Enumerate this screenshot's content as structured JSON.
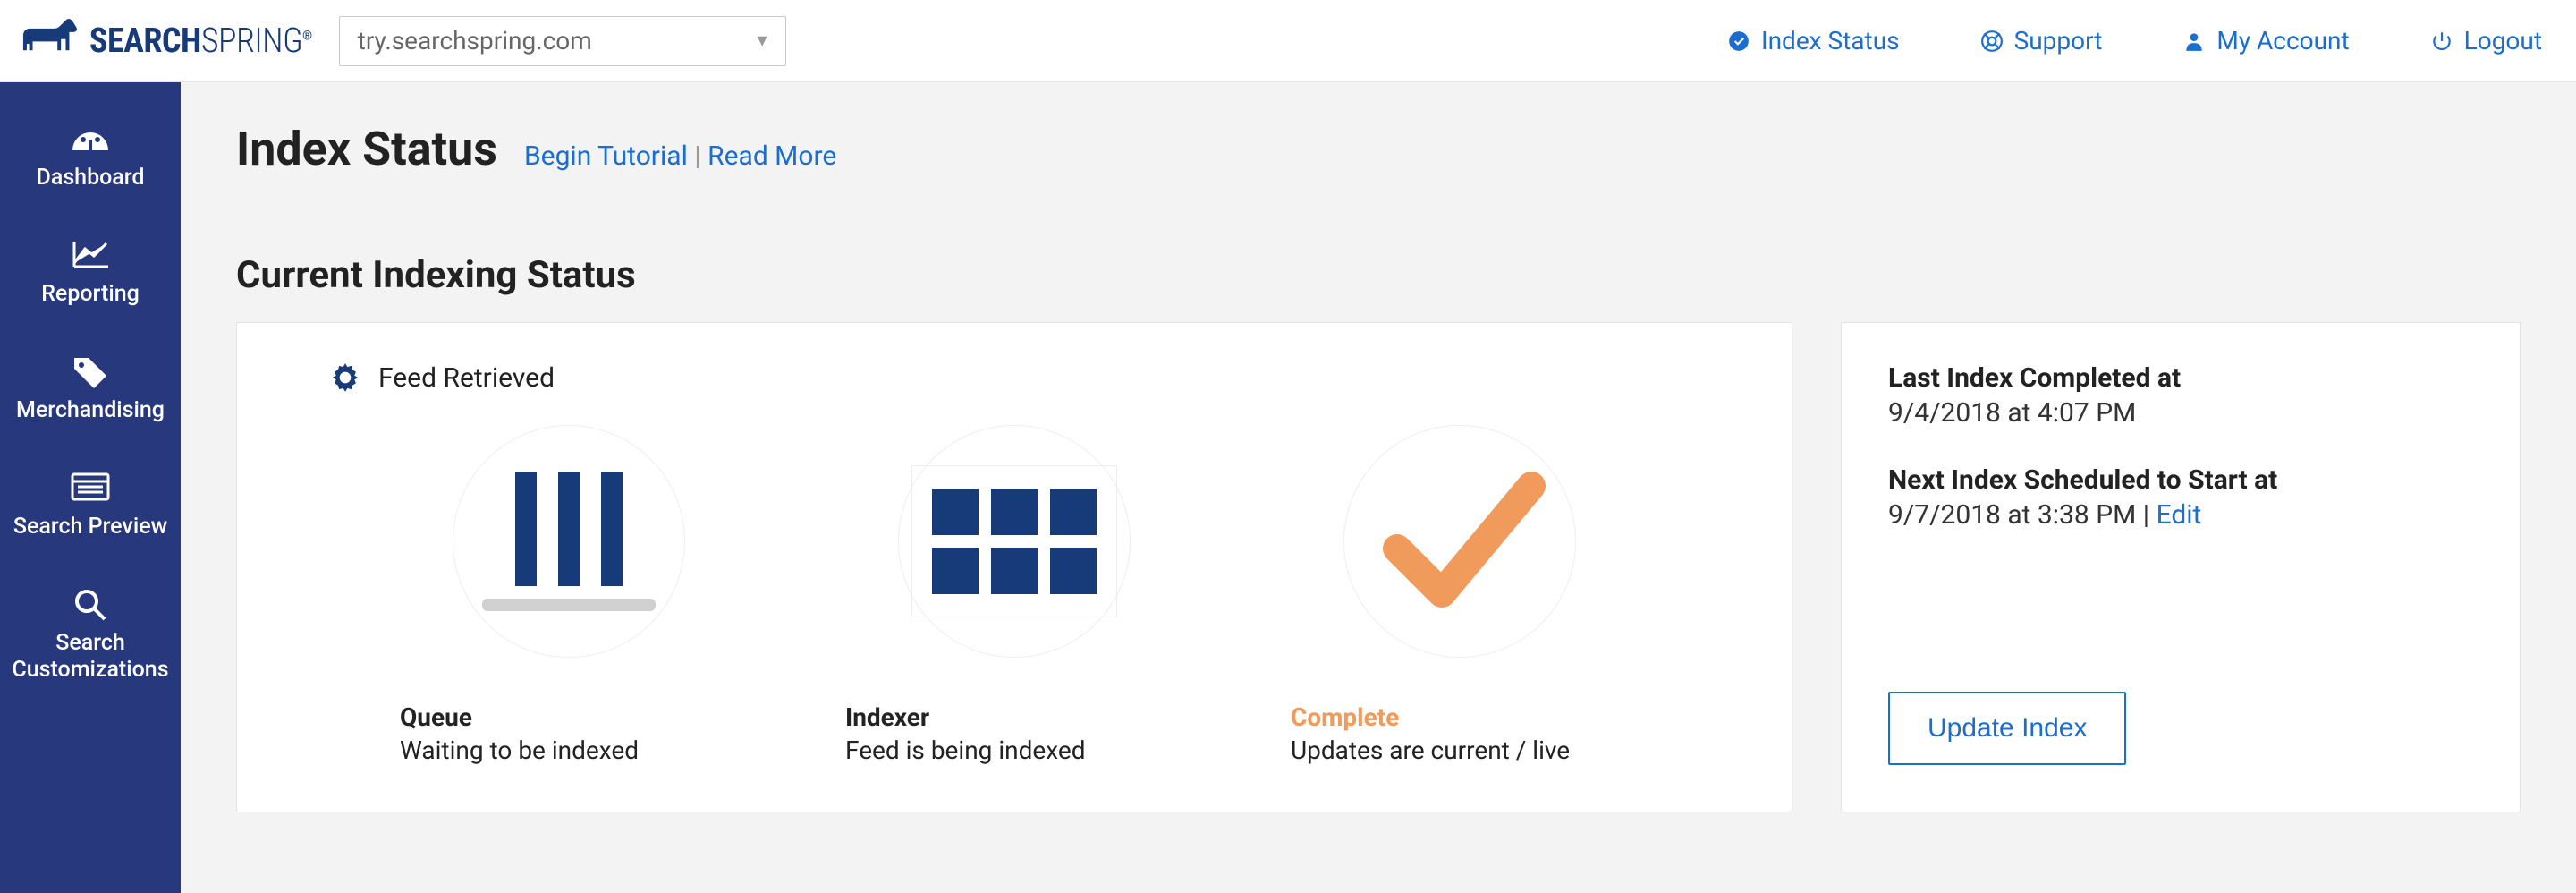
{
  "header": {
    "brand": {
      "primary": "SEARCH",
      "secondary": "SPRING"
    },
    "site_selected": "try.searchspring.com",
    "nav": {
      "index_status": "Index Status",
      "support": "Support",
      "my_account": "My Account",
      "logout": "Logout"
    }
  },
  "sidebar": {
    "items": [
      {
        "label": "Dashboard"
      },
      {
        "label": "Reporting"
      },
      {
        "label": "Merchandising"
      },
      {
        "label": "Search Preview"
      },
      {
        "label": "Search Customizations"
      }
    ]
  },
  "page": {
    "title": "Index Status",
    "tutorial_link": "Begin Tutorial",
    "read_more_link": "Read More",
    "link_separator": "  |  ",
    "section_title": "Current Indexing Status",
    "feed_retrieved": "Feed Retrieved",
    "stages": {
      "queue": {
        "label": "Queue",
        "desc": "Waiting to be indexed"
      },
      "indexer": {
        "label": "Indexer",
        "desc": "Feed is being indexed"
      },
      "complete": {
        "label": "Complete",
        "desc": "Updates are current / live"
      }
    },
    "info": {
      "last_label": "Last Index Completed at",
      "last_value": "9/4/2018 at 4:07 PM",
      "next_label": "Next Index Scheduled to Start at",
      "next_value": "9/7/2018 at 3:38 PM",
      "next_sep": " | ",
      "edit": "Edit",
      "update_button": "Update Index"
    }
  },
  "colors": {
    "brand_navy": "#173a79",
    "link_blue": "#1c6dd0",
    "accent_orange": "#f09a5b",
    "sidebar_bg": "#27387d"
  }
}
